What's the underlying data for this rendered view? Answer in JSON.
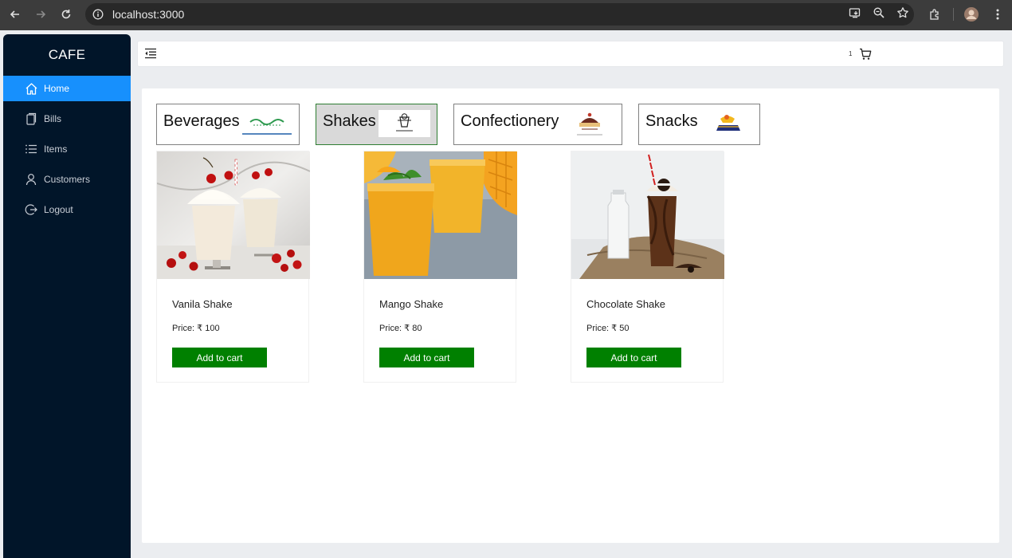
{
  "browser": {
    "url": "localhost:3000"
  },
  "sidebar": {
    "brand": "CAFE",
    "items": [
      {
        "label": "Home",
        "icon": "home-icon",
        "active": true
      },
      {
        "label": "Bills",
        "icon": "bill-icon",
        "active": false
      },
      {
        "label": "Items",
        "icon": "list-icon",
        "active": false
      },
      {
        "label": "Customers",
        "icon": "user-icon",
        "active": false
      },
      {
        "label": "Logout",
        "icon": "logout-icon",
        "active": false
      }
    ]
  },
  "header": {
    "cart_count": "1"
  },
  "categories": [
    {
      "label": "Beverages",
      "active": false
    },
    {
      "label": "Shakes",
      "active": true
    },
    {
      "label": "Confectionery",
      "active": false
    },
    {
      "label": "Snacks",
      "active": false
    }
  ],
  "products": [
    {
      "name": "Vanila Shake",
      "price_label": "Price: ₹ 100",
      "button": "Add to cart"
    },
    {
      "name": "Mango Shake",
      "price_label": "Price: ₹ 80",
      "button": "Add to cart"
    },
    {
      "name": "Chocolate Shake",
      "price_label": "Price: ₹ 50",
      "button": "Add to cart"
    }
  ],
  "colors": {
    "sidebar_bg": "#011529",
    "active_menu": "#1790fd",
    "add_button": "#008000"
  }
}
